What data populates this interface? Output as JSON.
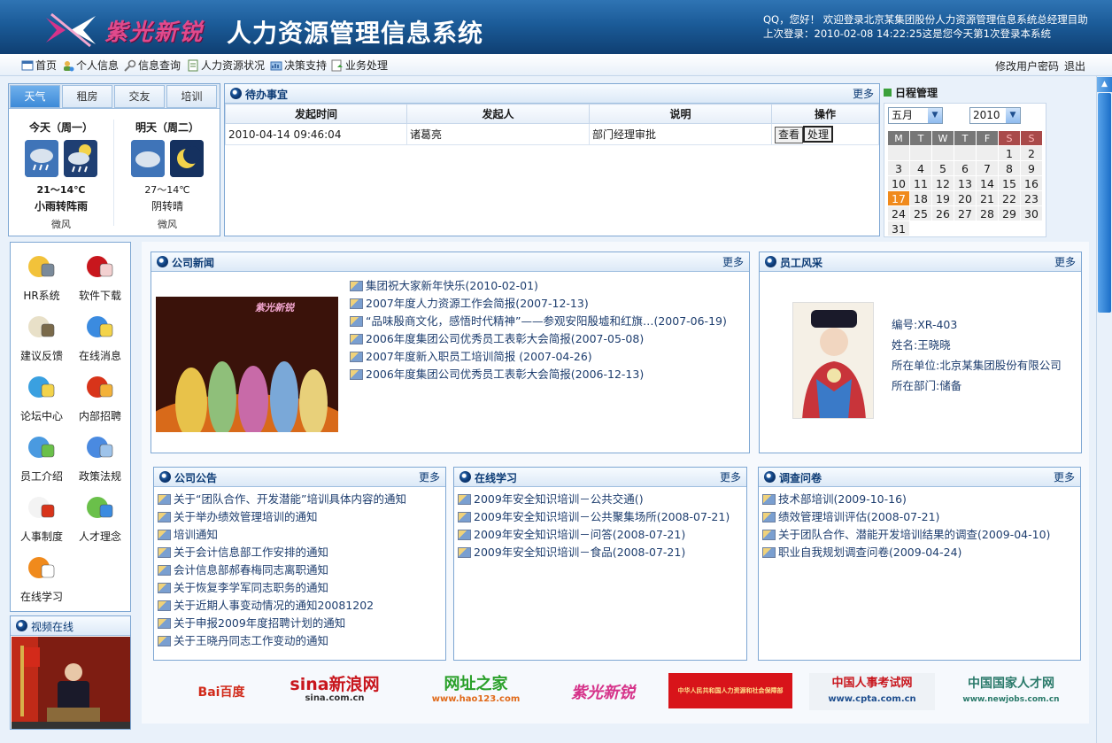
{
  "header": {
    "logo_text": "紫光新锐",
    "system_title": "人力资源管理信息系统",
    "welcome_line1": "QQ，您好！  欢迎登录北京某集团股份人力资源管理信息系统总经理目助",
    "welcome_line2": "上次登录：2010-02-08 14:22:25这是您今天第1次登录本系统"
  },
  "nav": {
    "items": [
      "首页",
      "个人信息",
      "信息查询",
      "人力资源状况",
      "决策支持",
      "业务处理"
    ],
    "change_password": "修改用户密码",
    "logout": "退出"
  },
  "weather": {
    "tabs": [
      "天气",
      "租房",
      "交友",
      "培训"
    ],
    "today": {
      "day": "今天（周一）",
      "temp": "21～14℃",
      "desc": "小雨转阵雨",
      "wind": "微风"
    },
    "tomorrow": {
      "day": "明天（周二）",
      "temp": "27～14℃",
      "desc": "阴转晴",
      "wind": "微风"
    }
  },
  "todo": {
    "title": "待办事宜",
    "more": "更多",
    "columns": [
      "发起时间",
      "发起人",
      "说明",
      "操作"
    ],
    "rows": [
      {
        "time": "2010-04-14 09:46:04",
        "initiator": "诸葛亮",
        "desc": "部门经理审批",
        "view": "查看",
        "handle": "处理"
      }
    ]
  },
  "calendar": {
    "title": "日程管理",
    "month": "五月",
    "year": "2010",
    "weekdays": [
      "M",
      "T",
      "W",
      "T",
      "F",
      "S",
      "S"
    ],
    "leading_blanks": 5,
    "days": 31,
    "today": 17
  },
  "quick_links": [
    "HR系统",
    "软件下载",
    "建议反馈",
    "在线消息",
    "论坛中心",
    "内部招聘",
    "员工介绍",
    "政策法规",
    "人事制度",
    "人才理念",
    "在线学习"
  ],
  "video": {
    "title": "视频在线"
  },
  "company_news": {
    "title": "公司新闻",
    "more": "更多",
    "photo_caption": "紫光新锐",
    "items": [
      "集团祝大家新年快乐(2010-02-01)",
      "2007年度人力资源工作会简报(2007-12-13)",
      "“品味殷商文化，感悟时代精神”——参观安阳殷墟和红旗…(2007-06-19)",
      "2006年度集团公司优秀员工表彰大会简报(2007-05-08)",
      "2007年度新入职员工培训简报 (2007-04-26)",
      "2006年度集团公司优秀员工表彰大会简报(2006-12-13)"
    ]
  },
  "staff": {
    "title": "员工风采",
    "more": "更多",
    "id": "编号:XR-403",
    "name": "姓名:王晓晓",
    "unit": "所在单位:北京某集团股份有限公司",
    "dept": "所在部门:储备"
  },
  "notices": {
    "title": "公司公告",
    "more": "更多",
    "items": [
      "关于“团队合作、开发潜能”培训具体内容的通知",
      "关于举办绩效管理培训的通知",
      "培训通知",
      "关于会计信息部工作安排的通知",
      "会计信息部郝春梅同志离职通知",
      "关于恢复李学军同志职务的通知",
      "关于近期人事变动情况的通知20081202",
      "关于申报2009年度招聘计划的通知",
      "关于王晓丹同志工作变动的通知"
    ]
  },
  "learning": {
    "title": "在线学习",
    "more": "更多",
    "items": [
      "2009年安全知识培训－公共交通()",
      "2009年安全知识培训－公共聚集场所(2008-07-21)",
      "2009年安全知识培训－问答(2008-07-21)",
      "2009年安全知识培训－食品(2008-07-21)"
    ]
  },
  "survey": {
    "title": "调查问卷",
    "more": "更多",
    "items": [
      "技术部培训(2009-10-16)",
      "绩效管理培训评估(2008-07-21)",
      "关于团队合作、潜能开发培训结果的调查(2009-04-10)",
      "职业自我规划调查问卷(2009-04-24)"
    ]
  },
  "partner_logos": {
    "baidu": "Bai百度",
    "sina": "sina新浪网",
    "sina_url": "sina.com.cn",
    "hao123": "网址之家",
    "hao123_url": "www.hao123.com",
    "ziguang": "紫光新锐",
    "mohrss": "中华人民共和国人力资源和社会保障部",
    "cpta": "中国人事考试网",
    "cpta_url": "www.cpta.com.cn",
    "newjobs": "中国国家人才网",
    "newjobs_url": "www.newjobs.com.cn"
  },
  "colors": {
    "header_blue": "#1b5b98",
    "accent_title": "#0c3b75",
    "today_orange": "#f08a1c",
    "logo_pink": "#e04a8c"
  }
}
